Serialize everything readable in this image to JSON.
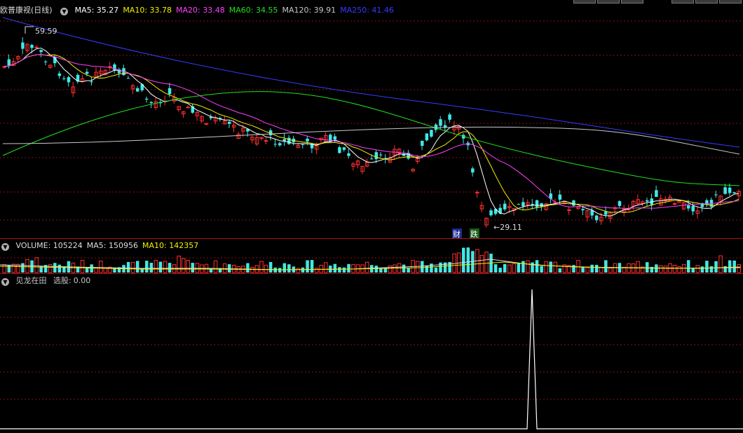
{
  "stock": {
    "name": "欧普康视",
    "period": "(日线)"
  },
  "main_indicators": [
    {
      "label": "MA5:",
      "value": "35.27",
      "color": "#ffffff"
    },
    {
      "label": "MA10:",
      "value": "33.78",
      "color": "#f0f000"
    },
    {
      "label": "MA20:",
      "value": "33.48",
      "color": "#ff40ff"
    },
    {
      "label": "MA60:",
      "value": "34.55",
      "color": "#20e020"
    },
    {
      "label": "MA120:",
      "value": "39.91",
      "color": "#c8c8c8"
    },
    {
      "label": "MA250:",
      "value": "41.46",
      "color": "#3a3aff"
    }
  ],
  "high_marker": "59.59",
  "low_marker": "29.11",
  "event_badges": {
    "fin": "财",
    "down": "跌"
  },
  "volume_indicators": [
    {
      "label": "VOLUME:",
      "value": "105224",
      "color": "#dcdcdc"
    },
    {
      "label": "MA5:",
      "value": "150956",
      "color": "#dcdcdc"
    },
    {
      "label": "MA10:",
      "value": "142357",
      "color": "#f0f000"
    }
  ],
  "lower_indicator": {
    "name": "见龙在田",
    "label": "选股:",
    "value": "0.00",
    "color": "#dcdcdc"
  },
  "colors": {
    "up": "#ff3030",
    "down": "#40e8e8",
    "grid": "#8a1010",
    "ma5": "#ffffff",
    "ma10": "#f0f000",
    "ma20": "#ff40ff",
    "ma60": "#20e020",
    "ma120": "#c8c8c8",
    "ma250": "#3a3aff"
  }
}
